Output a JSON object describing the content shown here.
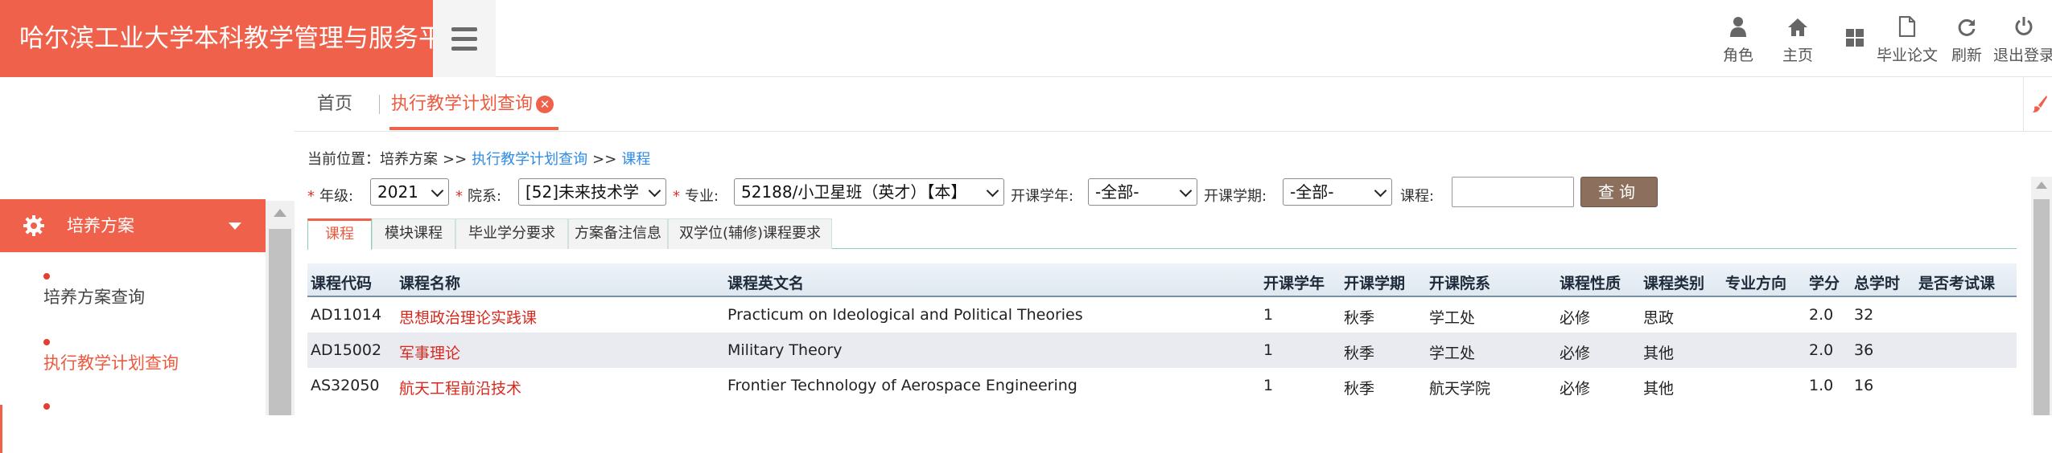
{
  "app": {
    "title": "哈尔滨工业大学本科教学管理与服务平台"
  },
  "topnav": [
    {
      "label": "角色",
      "icon": "user-icon"
    },
    {
      "label": "主页",
      "icon": "home-icon"
    },
    {
      "label": "",
      "icon": "grid-icon"
    },
    {
      "label": "毕业论文",
      "icon": "document-icon"
    },
    {
      "label": "刷新",
      "icon": "refresh-icon"
    },
    {
      "label": "退出登录",
      "icon": "power-icon"
    }
  ],
  "sidebar": {
    "section_label": "培养方案",
    "items": [
      {
        "label": "培养方案查询"
      },
      {
        "label": "执行教学计划查询"
      },
      {
        "label": ""
      }
    ]
  },
  "tabs": {
    "home": "首页",
    "active": "执行教学计划查询",
    "close_symbol": "✕"
  },
  "breadcrumb": {
    "prefix": "当前位置：",
    "level1": "培养方案",
    "level2": "执行教学计划查询",
    "level3": "课程",
    "sep": ">>"
  },
  "filters": {
    "grade_label": "年级:",
    "grade_value": "2021",
    "dept_label": "院系:",
    "dept_value": "[52]未来技术学",
    "major_label": "专业:",
    "major_value": "52188/小卫星班（英才）【本】",
    "year_label": "开课学年:",
    "year_value": "-全部-",
    "term_label": "开课学期:",
    "term_value": "-全部-",
    "course_label": "课程:",
    "course_value": "",
    "query_button": "查询"
  },
  "subtabs": [
    "课程",
    "模块课程",
    "毕业学分要求",
    "方案备注信息",
    "双学位(辅修)课程要求"
  ],
  "table": {
    "headers": [
      "课程代码",
      "课程名称",
      "课程英文名",
      "开课学年",
      "开课学期",
      "开课院系",
      "课程性质",
      "课程类别",
      "专业方向",
      "学分",
      "总学时",
      "是否考试课"
    ],
    "rows": [
      [
        "AD11014",
        "思想政治理论实践课",
        "Practicum on Ideological and Political Theories",
        "1",
        "秋季",
        "学工处",
        "必修",
        "思政",
        "",
        "2.0",
        "32",
        ""
      ],
      [
        "AD15002",
        "军事理论",
        "Military Theory",
        "1",
        "秋季",
        "学工处",
        "必修",
        "其他",
        "",
        "2.0",
        "36",
        ""
      ],
      [
        "AS32050",
        "航天工程前沿技术",
        "Frontier Technology of Aerospace Engineering",
        "1",
        "秋季",
        "航天学院",
        "必修",
        "其他",
        "",
        "1.0",
        "16",
        ""
      ]
    ]
  },
  "colors": {
    "brand": "#f0614b",
    "link": "#2e8be6",
    "course_name": "#d9281d",
    "query_button": "#8d6f5d"
  }
}
